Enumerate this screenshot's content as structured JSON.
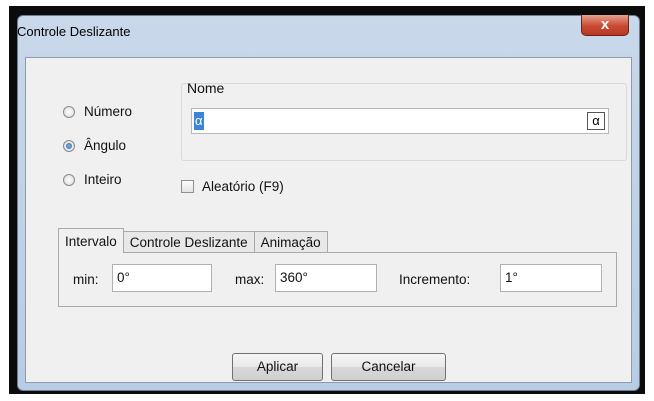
{
  "dialog": {
    "title": "Controle Deslizante",
    "close_symbol": "x"
  },
  "type_options": [
    {
      "label": "Número",
      "selected": false
    },
    {
      "label": "Ângulo",
      "selected": true
    },
    {
      "label": "Inteiro",
      "selected": false
    }
  ],
  "name_section": {
    "label": "Nome",
    "value": "α",
    "symbol_button": "α"
  },
  "random_checkbox": {
    "label": "Aleatório (F9)",
    "checked": false
  },
  "tabs": [
    {
      "label": "Intervalo",
      "active": true
    },
    {
      "label": "Controle Deslizante",
      "active": false
    },
    {
      "label": "Animação",
      "active": false
    }
  ],
  "interval": {
    "min_label": "min:",
    "min_value": "0°",
    "max_label": "max:",
    "max_value": "360°",
    "increment_label": "Incremento:",
    "increment_value": "1°"
  },
  "buttons": {
    "apply": "Aplicar",
    "cancel": "Cancelar"
  },
  "colors": {
    "title_bar": "#c9d8ea",
    "close_button": "#c84a33",
    "selection": "#3a85d6"
  }
}
